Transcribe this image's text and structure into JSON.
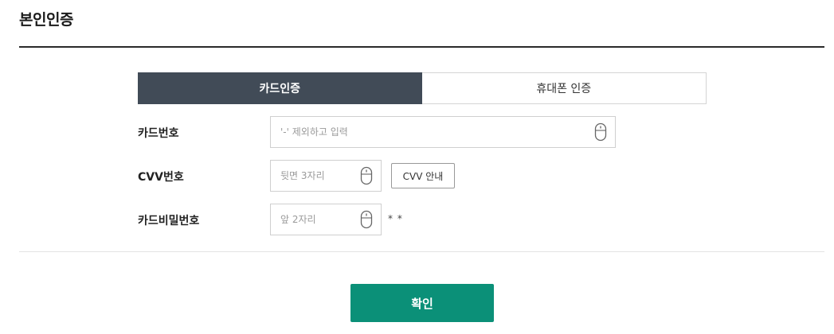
{
  "page": {
    "title": "본인인증"
  },
  "tabs": [
    {
      "label": "카드인증",
      "active": true
    },
    {
      "label": "휴대폰 인증",
      "active": false
    }
  ],
  "form": {
    "card_number": {
      "label": "카드번호",
      "placeholder": "'-' 제외하고 입력",
      "value": ""
    },
    "cvv": {
      "label": "CVV번호",
      "placeholder": "뒷면 3자리",
      "value": "",
      "guide_button": "CVV 안내"
    },
    "card_password": {
      "label": "카드비밀번호",
      "placeholder": "앞 2자리",
      "value": "",
      "masked_suffix": "* *"
    }
  },
  "actions": {
    "confirm_label": "확인"
  },
  "icons": {
    "secure_keypad": "mouse-icon"
  },
  "colors": {
    "tab_active": "#414b57",
    "confirm": "#0b9078"
  }
}
